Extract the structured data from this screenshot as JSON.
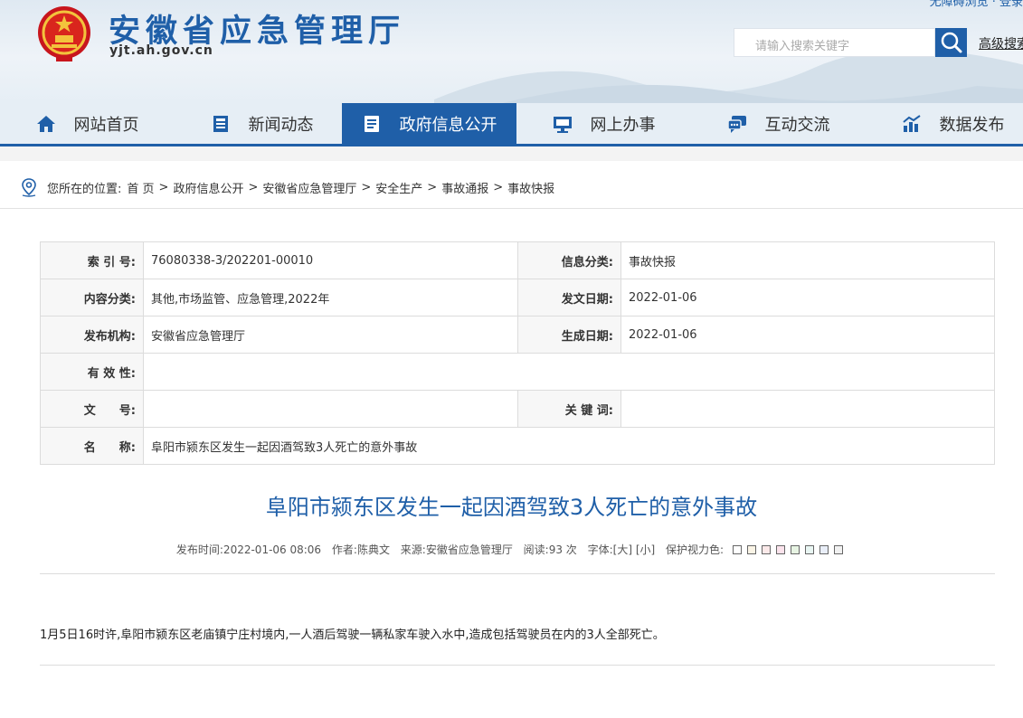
{
  "header": {
    "site_title": "安徽省应急管理厅",
    "site_url": "yjt.ah.gov.cn",
    "top_links": "无障碍浏览 · 登录",
    "search_placeholder": "请输入搜索关键字",
    "advanced_search": "高级搜索"
  },
  "nav": [
    {
      "label": "网站首页",
      "icon": "home-icon"
    },
    {
      "label": "新闻动态",
      "icon": "news-icon"
    },
    {
      "label": "政府信息公开",
      "icon": "document-icon",
      "active": true
    },
    {
      "label": "网上办事",
      "icon": "monitor-icon"
    },
    {
      "label": "互动交流",
      "icon": "chat-icon"
    },
    {
      "label": "数据发布",
      "icon": "chart-icon"
    }
  ],
  "breadcrumb": {
    "prefix": "您所在的位置:",
    "items": [
      "首 页",
      "政府信息公开",
      "安徽省应急管理厅",
      "安全生产",
      "事故通报",
      "事故快报"
    ]
  },
  "info_table": {
    "index_label": "索 引 号:",
    "index_value": "76080338-3/202201-00010",
    "category_label": "信息分类:",
    "category_value": "事故快报",
    "content_class_label": "内容分类:",
    "content_class_value": "其他,市场监管、应急管理,2022年",
    "issue_date_label": "发文日期:",
    "issue_date_value": "2022-01-06",
    "publisher_label": "发布机构:",
    "publisher_value": "安徽省应急管理厅",
    "gen_date_label": "生成日期:",
    "gen_date_value": "2022-01-06",
    "validity_label": "有 效 性:",
    "validity_value": "",
    "doc_no_label": "文　　号:",
    "doc_no_value": "",
    "keywords_label": "关 键 词:",
    "keywords_value": "",
    "name_label": "名　　称:",
    "name_value": "阜阳市颍东区发生一起因酒驾致3人死亡的意外事故"
  },
  "article": {
    "title": "阜阳市颍东区发生一起因酒驾致3人死亡的意外事故",
    "published": "发布时间:2022-01-06 08:06",
    "author": "作者:陈典文",
    "source": "来源:安徽省应急管理厅",
    "reads": "阅读:93 次",
    "font_size": "字体:[大] [小]",
    "eye_care": "保护视力色:",
    "eye_care_colors": [
      "#ffffff",
      "#faf4e6",
      "#fbe9e9",
      "#fbe3ec",
      "#e7f4e3",
      "#e9f6f3",
      "#e9eef8",
      "#f1f1f1"
    ],
    "body": "1月5日16时许,阜阳市颍东区老庙镇宁庄村境内,一人酒后驾驶一辆私家车驶入水中,造成包括驾驶员在内的3人全部死亡。"
  }
}
